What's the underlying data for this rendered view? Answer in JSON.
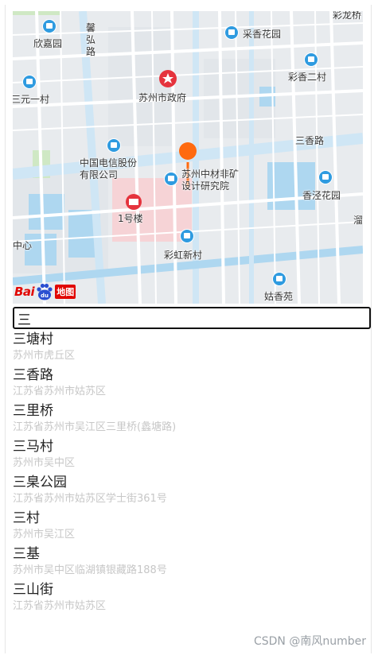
{
  "map": {
    "labels": {
      "xinjiayuan": "欣嘉园",
      "xiehong_road": "馨弘路",
      "caixiang_garden": "采香花园",
      "caixiang_ercun": "彩香二村",
      "caixiang_top": "彩龙桥",
      "sanyuan_yicun": "三元一村",
      "city_gov": "苏州市政府",
      "sanxiang_road": "三香路",
      "telecom": "中国电信股份\n有限公司",
      "zhongcai_institute": "苏州中材非矿\n设计研究院",
      "xiangjing_garden": "香泾花园",
      "building_1": "1号楼",
      "center": "中心",
      "caihong_xincun": "彩虹新村",
      "guxiang_yuan": "姑香苑",
      "edge_right": "溜"
    },
    "logo": {
      "bai": "Bai",
      "du": "du",
      "map_text": "地图"
    },
    "colors": {
      "road": "#ffffff",
      "main_road": "#cfe6f5",
      "water": "#aed7f0",
      "block": "#e9ecef",
      "hospital": "#f6d3d6",
      "green": "#cfe8c4",
      "marker": "#ff6a0f",
      "poi": "#2f9be0"
    }
  },
  "search": {
    "value": "三"
  },
  "suggestions": [
    {
      "name": "三塘村",
      "address": "苏州市虎丘区"
    },
    {
      "name": "三香路",
      "address": "江苏省苏州市姑苏区"
    },
    {
      "name": "三里桥",
      "address": "江苏省苏州市吴江区三里桥(蠡塘路)"
    },
    {
      "name": "三马村",
      "address": "苏州市吴中区"
    },
    {
      "name": "三臬公园",
      "address": "江苏省苏州市姑苏区学士街361号"
    },
    {
      "name": "三村",
      "address": "苏州市吴江区"
    },
    {
      "name": "三基",
      "address": "苏州市吴中区临湖镇银藏路188号"
    },
    {
      "name": "三山街",
      "address": "江苏省苏州市姑苏区"
    }
  ],
  "watermark": "CSDN @南风number"
}
